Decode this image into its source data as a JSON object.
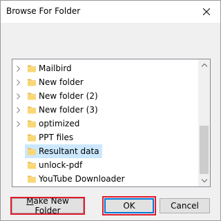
{
  "window": {
    "title": "Browse For Folder"
  },
  "tree": {
    "items": [
      {
        "label": "Mailbird",
        "has_children": true,
        "selected": false
      },
      {
        "label": "New folder",
        "has_children": true,
        "selected": false
      },
      {
        "label": "New folder (2)",
        "has_children": true,
        "selected": false
      },
      {
        "label": "New folder (3)",
        "has_children": true,
        "selected": false
      },
      {
        "label": "optimized",
        "has_children": true,
        "selected": false
      },
      {
        "label": "PPT files",
        "has_children": false,
        "selected": false
      },
      {
        "label": "Resultant data",
        "has_children": false,
        "selected": true
      },
      {
        "label": "unlock-pdf",
        "has_children": false,
        "selected": false
      },
      {
        "label": "YouTube Downloader",
        "has_children": false,
        "selected": false
      }
    ]
  },
  "buttons": {
    "new_folder": "Make New Folder",
    "ok": "OK",
    "cancel": "Cancel"
  },
  "colors": {
    "selection": "#cce8ff",
    "highlight_box": "#e21b2b",
    "default_button_border": "#0078d7",
    "folder": "#f8d775"
  }
}
